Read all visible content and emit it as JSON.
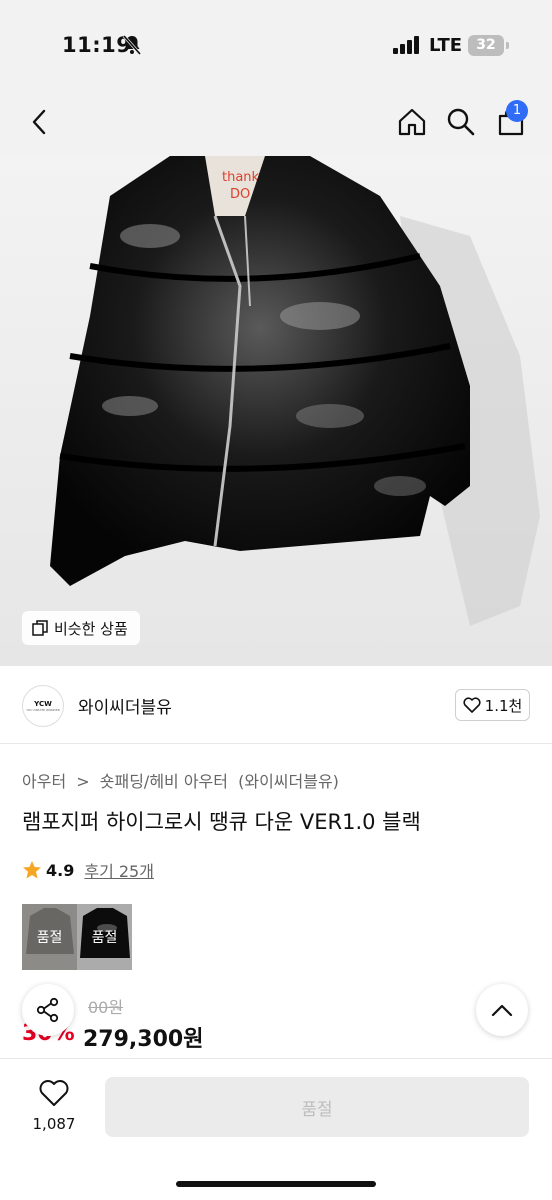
{
  "status_bar": {
    "time": "11:19",
    "network": "LTE",
    "battery": "32"
  },
  "nav": {
    "cart_count": "1"
  },
  "hero": {
    "similar_label": "비슷한 상품"
  },
  "brand": {
    "logo_text": "YCW",
    "logo_subtext": "YOU CREATE WONDER",
    "name": "와이씨더블유",
    "likes": "1.1천"
  },
  "breadcrumb": [
    "아우터",
    ">",
    "숏패딩/헤비 아우터",
    "(와이씨더블유)"
  ],
  "product": {
    "title": "램포지퍼 하이그로시 땡큐 다운 VER1.0 블랙",
    "rating": "4.9",
    "reviews": "후기 25개",
    "options": [
      {
        "label": "품절",
        "color": "gray"
      },
      {
        "label": "품절",
        "color": "black"
      }
    ],
    "original_price": "00원",
    "discount": "30%",
    "sale_price": "279,300원"
  },
  "bottom_bar": {
    "wish_count": "1,087",
    "soldout_label": "품절"
  },
  "colors": {
    "accent": "#2f6df6",
    "discount": "#e60023"
  }
}
